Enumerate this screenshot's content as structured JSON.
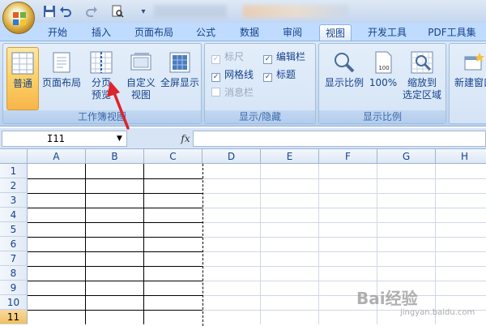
{
  "quick_access": {
    "more_label": "▾"
  },
  "tabs": [
    {
      "label": "开始"
    },
    {
      "label": "插入"
    },
    {
      "label": "页面布局"
    },
    {
      "label": "公式"
    },
    {
      "label": "数据"
    },
    {
      "label": "审阅"
    },
    {
      "label": "视图",
      "active": true
    },
    {
      "label": "开发工具"
    },
    {
      "label": "PDF工具集"
    }
  ],
  "groups": {
    "workbook_views": {
      "label": "工作簿视图",
      "buttons": {
        "normal": "普通",
        "page_layout": "页面布局",
        "page_break_line1": "分页",
        "page_break_line2": "预览",
        "custom_line1": "自定义",
        "custom_line2": "视图",
        "fullscreen": "全屏显示"
      }
    },
    "show_hide": {
      "label": "显示/隐藏",
      "items": {
        "ruler": "标尺",
        "formula_bar": "编辑栏",
        "gridlines": "网格线",
        "headings": "标题",
        "message_bar": "消息栏"
      }
    },
    "zoom": {
      "label": "显示比例",
      "buttons": {
        "zoom": "显示比例",
        "zoom100": "100%",
        "zoom_sel_line1": "缩放到",
        "zoom_sel_line2": "选定区域"
      }
    },
    "window": {
      "buttons": {
        "new_window": "新建窗口"
      }
    }
  },
  "formula_bar": {
    "name_box": "I11",
    "fx": "fx",
    "value": ""
  },
  "sheet": {
    "columns": [
      "A",
      "B",
      "C",
      "D",
      "E",
      "F",
      "G",
      "H"
    ],
    "rows": [
      "1",
      "2",
      "3",
      "4",
      "5",
      "6",
      "7",
      "8",
      "9",
      "10",
      "11"
    ],
    "selected_row": "11"
  },
  "icon_text": {
    "page_number": "100"
  },
  "watermark": {
    "text": "Bai经验",
    "sub": "jingyan.baidu.com"
  },
  "colors": {
    "accent": "#15428b",
    "arrow": "#e0222a",
    "active_tab": "#ffffff",
    "selected": "#f7b54a"
  }
}
